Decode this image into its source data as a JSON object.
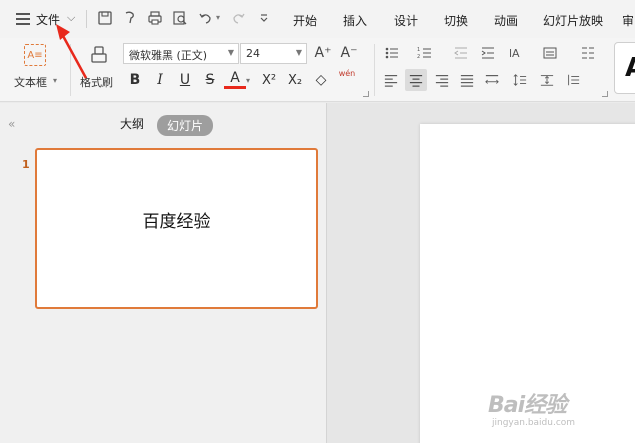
{
  "menubar": {
    "file_label": "文件",
    "tabs": [
      "开始",
      "插入",
      "设计",
      "切换",
      "动画",
      "幻灯片放映",
      "审"
    ]
  },
  "ribbon": {
    "textbox_label": "文本框",
    "textbox_icon_text": "A≡",
    "format_painter_label": "格式刷",
    "font_name": "微软雅黑 (正文)",
    "font_size": "24",
    "grow_font": "A⁺",
    "shrink_font": "A⁻",
    "bold": "B",
    "italic": "I",
    "underline": "U",
    "strike": "S",
    "font_color": "A",
    "superscript": "X²",
    "subscript": "X₂",
    "eraser": "◇",
    "phonetic": "wén",
    "style_preview": "A"
  },
  "leftpane": {
    "outline_tab": "大纲",
    "slides_tab": "幻灯片",
    "slide_number": "1",
    "slide_title": "百度经验"
  },
  "watermark": {
    "logo_text": "Bai经验",
    "url": "jingyan.baidu.com"
  },
  "colors": {
    "accent": "#e07a3a",
    "arrow": "#e8291c"
  }
}
